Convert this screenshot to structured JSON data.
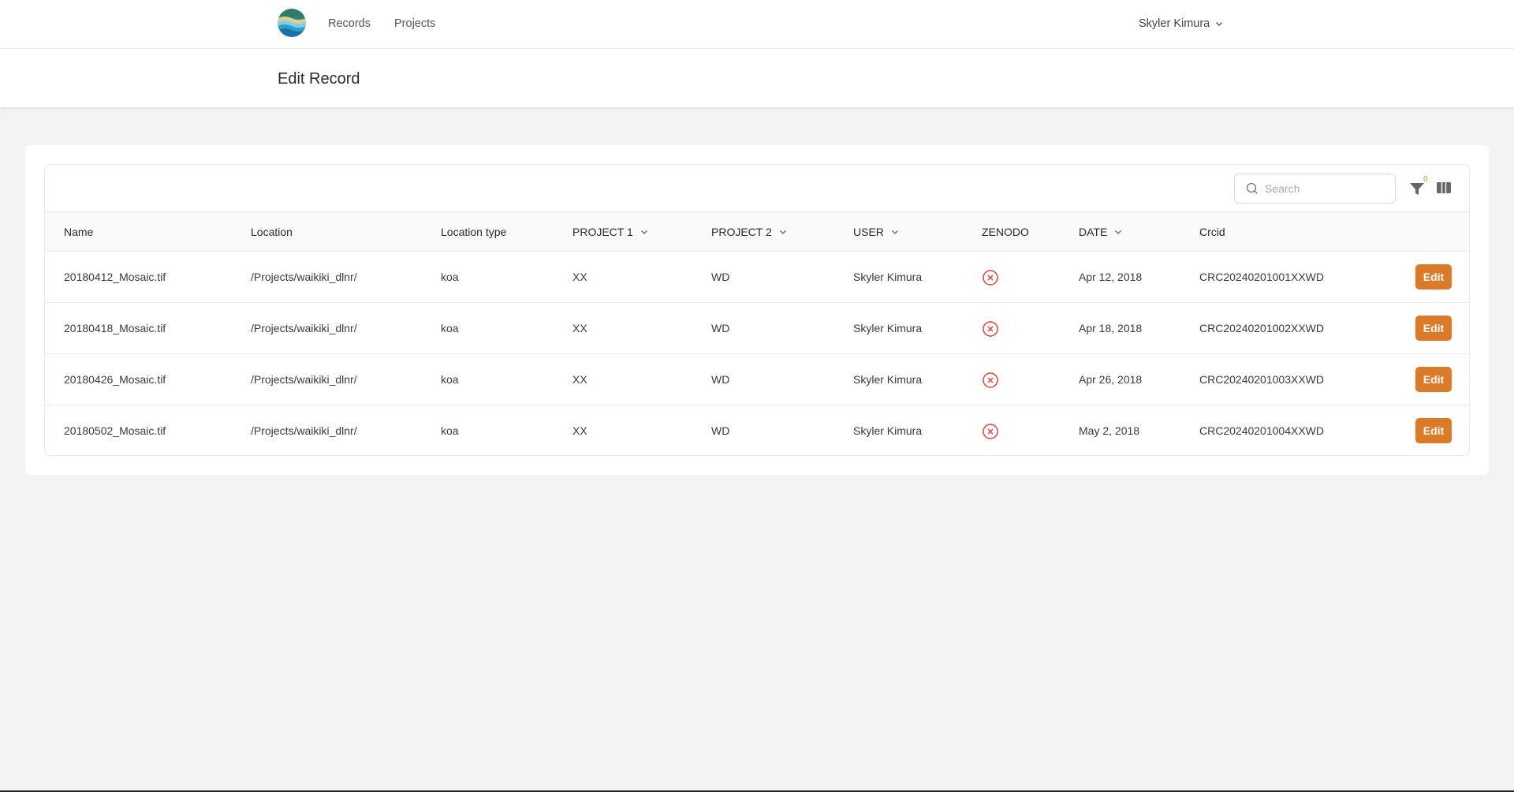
{
  "nav": {
    "logo": "ocean-logo",
    "links": [
      "Records",
      "Projects"
    ],
    "user_name": "Skyler Kimura"
  },
  "header": {
    "title": "Edit Record"
  },
  "toolbar": {
    "search_placeholder": "Search",
    "filter_count": "0"
  },
  "table": {
    "columns": [
      "Name",
      "Location",
      "Location type",
      "PROJECT 1",
      "PROJECT 2",
      "USER",
      "ZENODO",
      "DATE",
      "Crcid"
    ],
    "rows": [
      {
        "name": "20180412_Mosaic.tif",
        "location": "/Projects/waikiki_dlnr/",
        "location_type": "koa",
        "project1": "XX",
        "project2": "WD",
        "user": "Skyler Kimura",
        "zenodo": "x-circle-icon",
        "date": "Apr 12, 2018",
        "crcid": "CRC20240201001XXWD",
        "action": "Edit"
      },
      {
        "name": "20180418_Mosaic.tif",
        "location": "/Projects/waikiki_dlnr/",
        "location_type": "koa",
        "project1": "XX",
        "project2": "WD",
        "user": "Skyler Kimura",
        "zenodo": "x-circle-icon",
        "date": "Apr 18, 2018",
        "crcid": "CRC20240201002XXWD",
        "action": "Edit"
      },
      {
        "name": "20180426_Mosaic.tif",
        "location": "/Projects/waikiki_dlnr/",
        "location_type": "koa",
        "project1": "XX",
        "project2": "WD",
        "user": "Skyler Kimura",
        "zenodo": "x-circle-icon",
        "date": "Apr 26, 2018",
        "crcid": "CRC20240201003XXWD",
        "action": "Edit"
      },
      {
        "name": "20180502_Mosaic.tif",
        "location": "/Projects/waikiki_dlnr/",
        "location_type": "koa",
        "project1": "XX",
        "project2": "WD",
        "user": "Skyler Kimura",
        "zenodo": "x-circle-icon",
        "date": "May 2, 2018",
        "crcid": "CRC20240201004XXWD",
        "action": "Edit"
      }
    ]
  },
  "colors": {
    "accent": "#dd7a27",
    "error": "#e0443e",
    "badge": "#d9921f"
  }
}
